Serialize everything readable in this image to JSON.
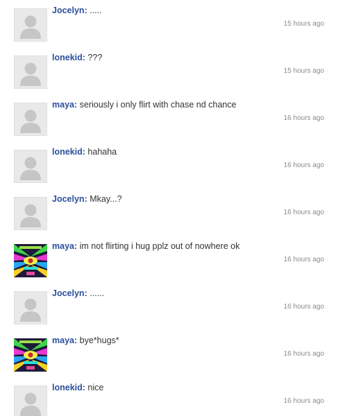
{
  "comments": [
    {
      "author": "Jocelyn",
      "text": ".....",
      "time": "15 hours ago",
      "avatar": "default-avatar"
    },
    {
      "author": "lonekid",
      "text": "???",
      "time": "15 hours ago",
      "avatar": "default-avatar"
    },
    {
      "author": "maya",
      "text": "seriously i only flirt with chase nd chance",
      "time": "16 hours ago",
      "avatar": "default-avatar"
    },
    {
      "author": "lonekid",
      "text": "hahaha",
      "time": "16 hours ago",
      "avatar": "default-avatar"
    },
    {
      "author": "Jocelyn",
      "text": "Mkay...?",
      "time": "16 hours ago",
      "avatar": "default-avatar"
    },
    {
      "author": "maya",
      "text": "im not flirting i hug pplz out of nowhere ok",
      "time": "16 hours ago",
      "avatar": "psychedelic-avatar"
    },
    {
      "author": "Jocelyn",
      "text": "......",
      "time": "16 hours ago",
      "avatar": "default-avatar"
    },
    {
      "author": "maya",
      "text": "bye*hugs*",
      "time": "16 hours ago",
      "avatar": "psychedelic-avatar"
    },
    {
      "author": "lonekid",
      "text": "nice",
      "time": "16 hours ago",
      "avatar": "default-avatar"
    }
  ],
  "colors": {
    "author_link": "#2b4f9c",
    "message_text": "#333333",
    "timestamp": "#8a8a8a",
    "avatar_bg": "#e9e9e9",
    "avatar_silhouette": "#c6c6c6"
  }
}
